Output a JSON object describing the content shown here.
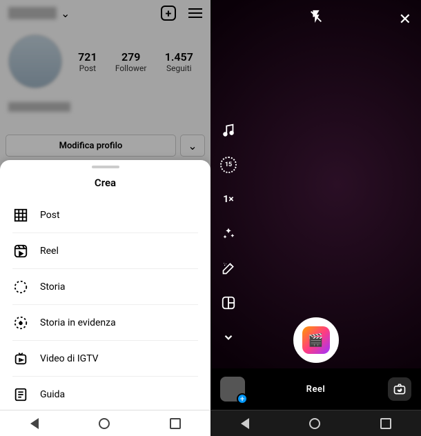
{
  "profile": {
    "stats": [
      {
        "num": "721",
        "label": "Post"
      },
      {
        "num": "279",
        "label": "Follower"
      },
      {
        "num": "1.457",
        "label": "Seguiti"
      }
    ],
    "edit_button": "Modifica profilo"
  },
  "sheet": {
    "title": "Crea",
    "items": [
      {
        "label": "Post"
      },
      {
        "label": "Reel"
      },
      {
        "label": "Storia"
      },
      {
        "label": "Storia in evidenza"
      },
      {
        "label": "Video di IGTV"
      },
      {
        "label": "Guida"
      }
    ]
  },
  "camera": {
    "timer": "15",
    "speed": "1×",
    "mode": "Reel"
  }
}
